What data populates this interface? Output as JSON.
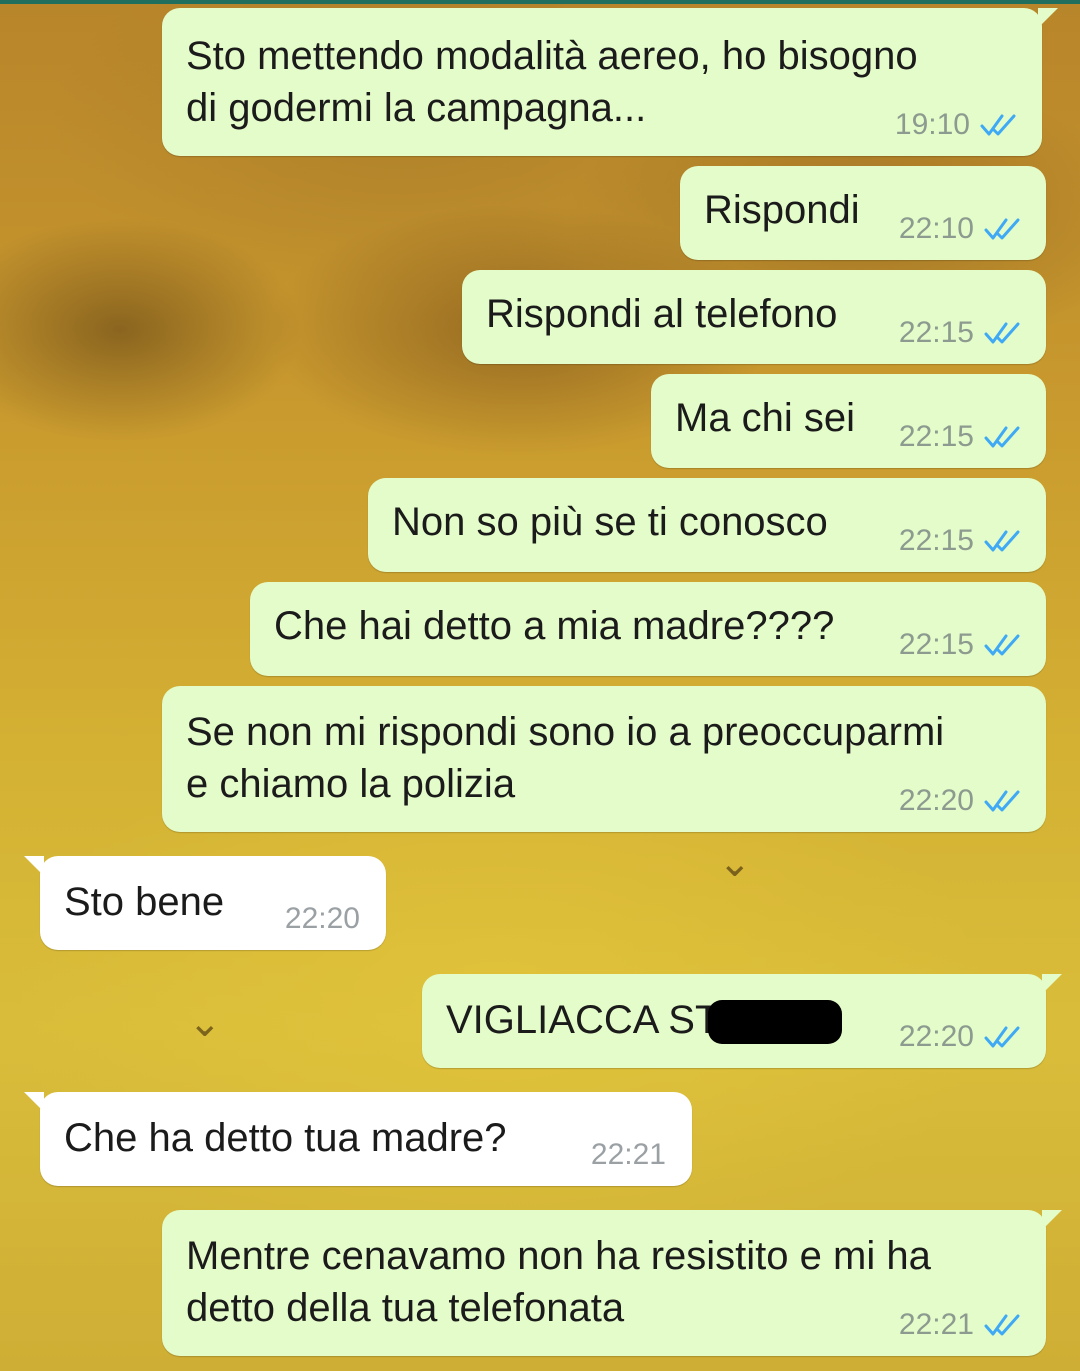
{
  "chat": {
    "messages": [
      {
        "text": "Sto mettendo modalità aereo, ho bisogno\ndi godermi la campagna...",
        "time": "19:10",
        "direction": "out",
        "status": "read"
      },
      {
        "text": "Rispondi",
        "time": "22:10",
        "direction": "out",
        "status": "read"
      },
      {
        "text": "Rispondi al telefono",
        "time": "22:15",
        "direction": "out",
        "status": "read"
      },
      {
        "text": "Ma chi sei",
        "time": "22:15",
        "direction": "out",
        "status": "read"
      },
      {
        "text": "Non so più se ti conosco",
        "time": "22:15",
        "direction": "out",
        "status": "read"
      },
      {
        "text": "Che hai detto a mia madre????",
        "time": "22:15",
        "direction": "out",
        "status": "read"
      },
      {
        "text": "Se non mi rispondi sono io a preoccuparmi\ne chiamo la polizia",
        "time": "22:20",
        "direction": "out",
        "status": "read"
      },
      {
        "text": "Sto bene",
        "time": "22:20",
        "direction": "in"
      },
      {
        "text": "VIGLIACCA ST        A",
        "time": "22:20",
        "direction": "out",
        "status": "read"
      },
      {
        "text": "Che ha detto tua madre?",
        "time": "22:21",
        "direction": "in"
      },
      {
        "text": "Mentre cenavamo non ha resistito e mi ha\ndetto della tua telefonata",
        "time": "22:21",
        "direction": "out",
        "status": "read"
      }
    ]
  },
  "colors": {
    "outgoing_bubble": "#e4fcc9",
    "incoming_bubble": "#ffffff",
    "read_ticks": "#3fa9f5",
    "header_strip": "#1f6e5e"
  },
  "icons": {
    "read_receipt": "double-check-icon"
  }
}
